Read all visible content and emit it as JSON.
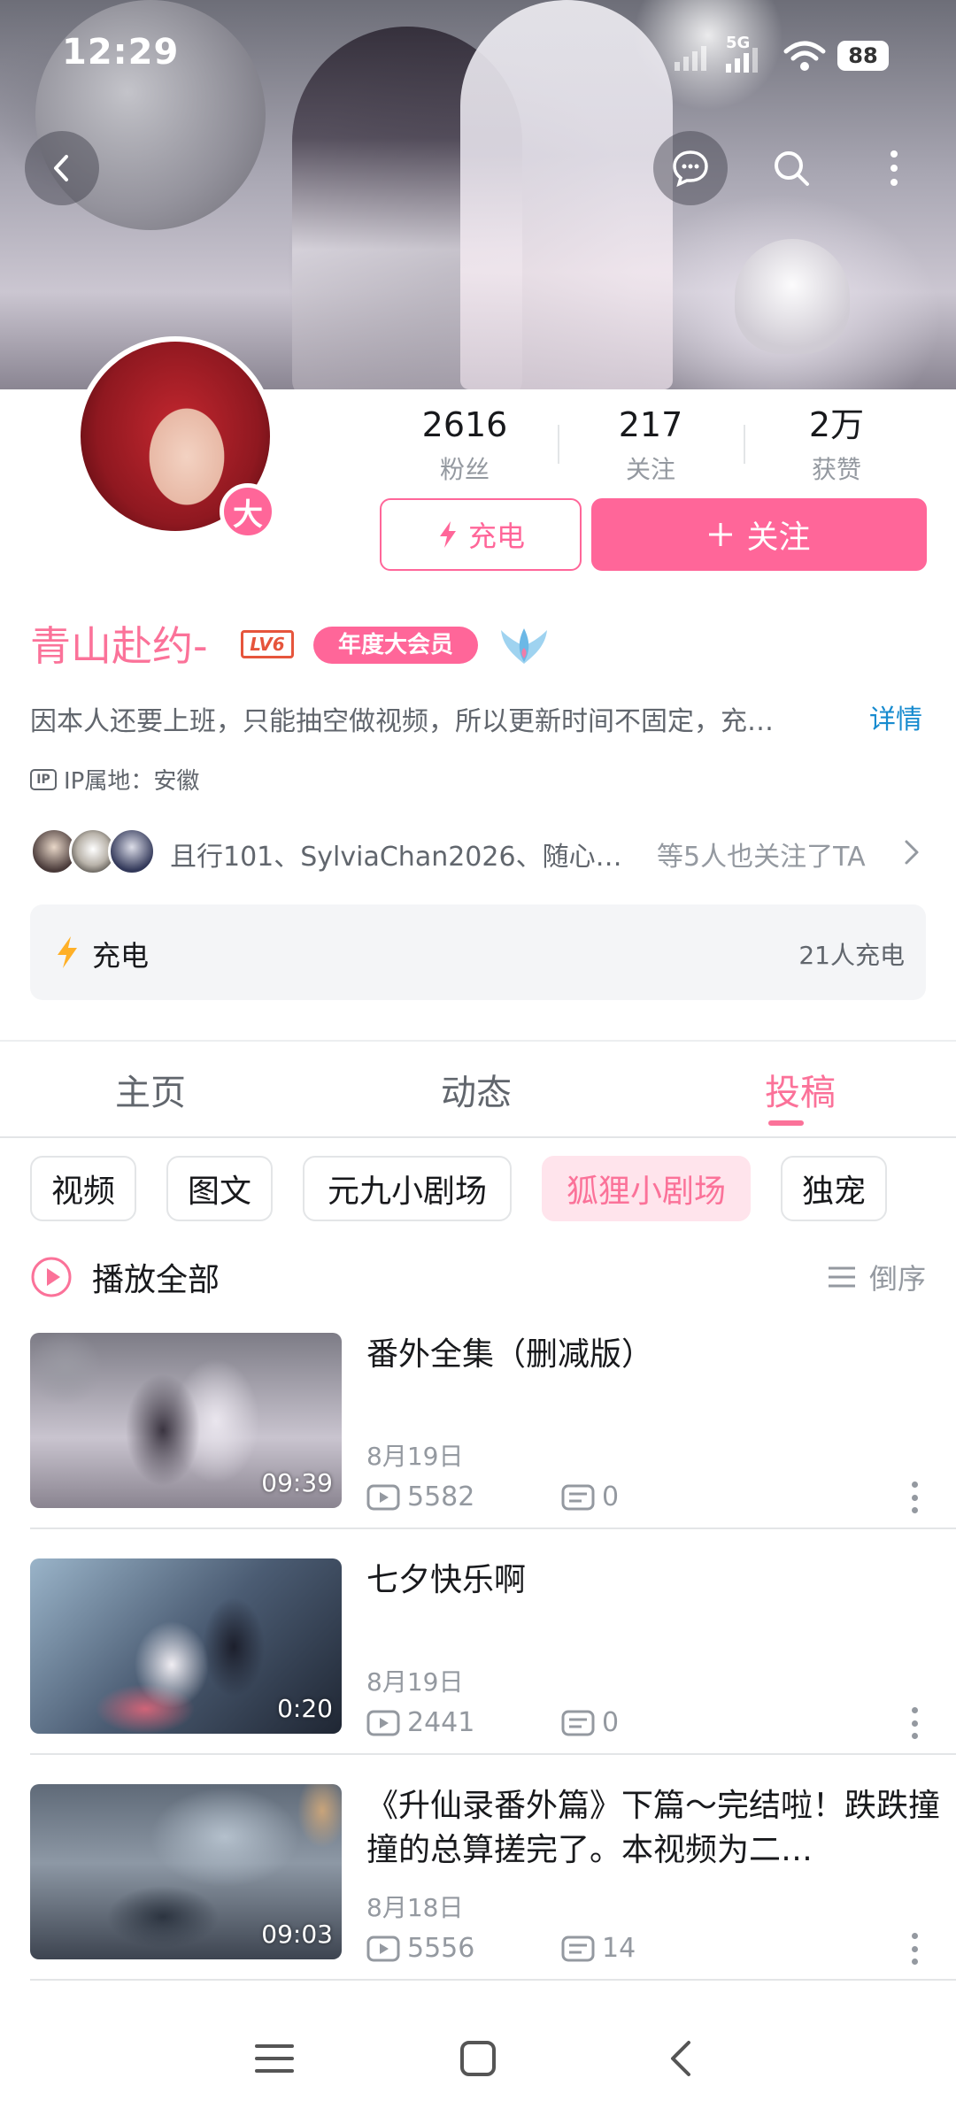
{
  "status_bar": {
    "time": "12:29",
    "network": "5G",
    "battery": "88"
  },
  "colors": {
    "brand_pink": "#fb7299",
    "button_pink": "#ff6699",
    "link_blue": "#178bcf",
    "level_red": "#e6553c"
  },
  "header": {
    "back_icon": "chevron-left-icon",
    "message_icon": "chat-bubble-icon",
    "search_icon": "search-icon",
    "more_icon": "more-vertical-icon"
  },
  "profile": {
    "vip_badge": "大",
    "stats": [
      {
        "value": "2616",
        "label": "粉丝"
      },
      {
        "value": "217",
        "label": "关注"
      },
      {
        "value": "2万",
        "label": "获赞"
      }
    ],
    "charge_button": "充电",
    "follow_button": "关注",
    "name": "青山赴约-",
    "level": "LV6",
    "vip_tag": "年度大会员",
    "bio": "因本人还要上班，只能抽空做视频，所以更新时间不固定，充…",
    "bio_more": "详情",
    "ip_icon_label": "IP",
    "ip_location": "IP属地：安徽",
    "mutual_followers": "且行101、SylviaChan2026、随心…",
    "mutual_followers_suffix": "等5人也关注了TA",
    "charge_card_label": "充电",
    "charge_card_count": "21人充电"
  },
  "tabs": [
    {
      "label": "主页",
      "active": false
    },
    {
      "label": "动态",
      "active": false
    },
    {
      "label": "投稿",
      "active": true
    }
  ],
  "filters": [
    {
      "label": "视频",
      "active": false
    },
    {
      "label": "图文",
      "active": false
    },
    {
      "label": "元九小剧场",
      "active": false
    },
    {
      "label": "狐狸小剧场",
      "active": true
    },
    {
      "label": "独宠",
      "active": false
    }
  ],
  "list_controls": {
    "play_all": "播放全部",
    "order": "倒序"
  },
  "videos": [
    {
      "title": "番外全集（删减版）",
      "duration": "09:39",
      "date": "8月19日",
      "views": "5582",
      "comments": "0"
    },
    {
      "title": "七夕快乐啊",
      "duration": "0:20",
      "date": "8月19日",
      "views": "2441",
      "comments": "0"
    },
    {
      "title": "《升仙录番外篇》下篇～完结啦！跌跌撞撞的总算搓完了。本视频为二…",
      "duration": "09:03",
      "date": "8月18日",
      "views": "5556",
      "comments": "14"
    }
  ]
}
